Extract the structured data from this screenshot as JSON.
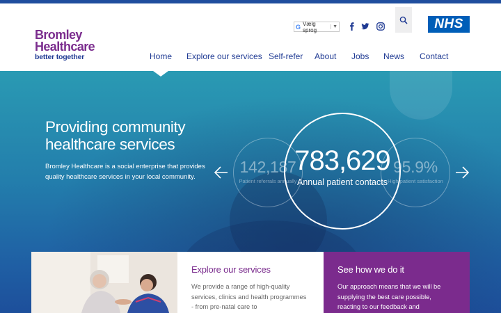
{
  "brand": {
    "logo_line1": "Bromley",
    "logo_line2": "Healthcare",
    "tagline": "better together",
    "partner_logo": "NHS"
  },
  "header": {
    "translate_label": "Vælg sprog",
    "translate_arrow": "▼",
    "social_icons": [
      "facebook-icon",
      "twitter-icon",
      "instagram-icon"
    ],
    "search_icon": "search-icon"
  },
  "nav": {
    "items": [
      {
        "label": "Home",
        "active": true
      },
      {
        "label": "Explore our services"
      },
      {
        "label": "Self-refer"
      },
      {
        "label": "About"
      },
      {
        "label": "Jobs"
      },
      {
        "label": "News"
      },
      {
        "label": "Contact"
      }
    ]
  },
  "hero": {
    "title_line1": "Providing community",
    "title_line2": "healthcare services",
    "text": "Bromley Healthcare is a social enterprise that provides quality healthcare services in your local community.",
    "prev_icon": "arrow-left-icon",
    "next_icon": "arrow-right-icon",
    "stats": [
      {
        "value": "142,187",
        "label": "Patient referrals annually"
      },
      {
        "value": "783,629",
        "label": "Annual patient contacts"
      },
      {
        "value": "95.9%",
        "label": "High patient satisfaction"
      }
    ]
  },
  "cards": [
    {
      "title": "Explore our services",
      "body": "We provide a range of high-quality services, clinics and health programmes - from pre-natal care to"
    },
    {
      "title": "See how we do it",
      "body": "Our approach means that we will be supplying the best care possible, reacting to our feedback and"
    }
  ],
  "colors": {
    "brand_purple": "#7b2d8e",
    "brand_navy": "#1f3a93",
    "nhs_blue": "#005eb8",
    "card_purple": "#7b2b8d"
  }
}
